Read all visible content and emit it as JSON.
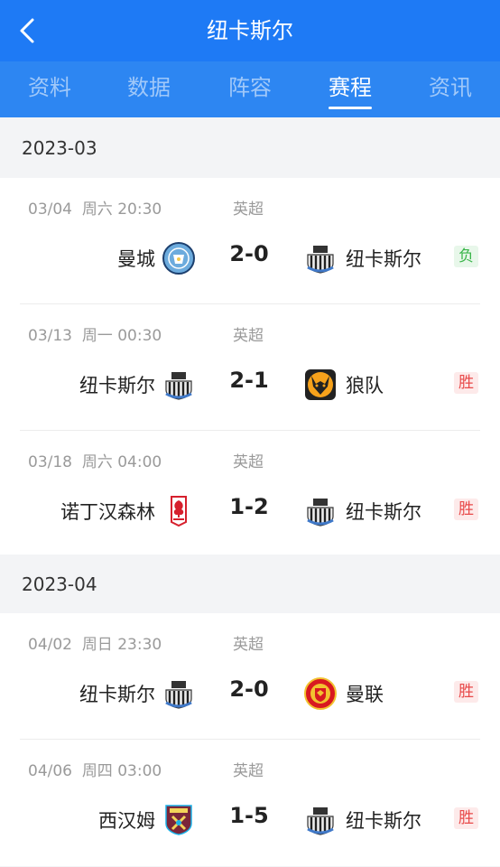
{
  "header": {
    "title": "纽卡斯尔"
  },
  "tabs": [
    {
      "label": "资料"
    },
    {
      "label": "数据"
    },
    {
      "label": "阵容"
    },
    {
      "label": "赛程"
    },
    {
      "label": "资讯"
    }
  ],
  "active_tab": "赛程",
  "months": [
    {
      "label": "2023-03"
    },
    {
      "label": "2023-04"
    }
  ],
  "matches": [
    {
      "date": "03/04",
      "weekday": "周六",
      "time": "20:30",
      "league": "英超",
      "home": "曼城",
      "score": "2-0",
      "away": "纽卡斯尔",
      "result": "负"
    },
    {
      "date": "03/13",
      "weekday": "周一",
      "time": "00:30",
      "league": "英超",
      "home": "纽卡斯尔",
      "score": "2-1",
      "away": "狼队",
      "result": "胜"
    },
    {
      "date": "03/18",
      "weekday": "周六",
      "time": "04:00",
      "league": "英超",
      "home": "诺丁汉森林",
      "score": "1-2",
      "away": "纽卡斯尔",
      "result": "胜"
    },
    {
      "date": "04/02",
      "weekday": "周日",
      "time": "23:30",
      "league": "英超",
      "home": "纽卡斯尔",
      "score": "2-0",
      "away": "曼联",
      "result": "胜"
    },
    {
      "date": "04/06",
      "weekday": "周四",
      "time": "03:00",
      "league": "英超",
      "home": "西汉姆",
      "score": "1-5",
      "away": "纽卡斯尔",
      "result": "胜"
    }
  ],
  "colors": {
    "brand": "#1e7af5",
    "win": "#e84a4a",
    "loss": "#3ab54a"
  }
}
